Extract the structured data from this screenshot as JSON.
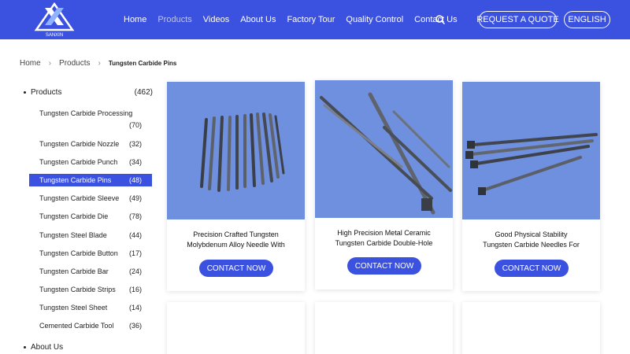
{
  "header": {
    "nav": [
      "Home",
      "Products",
      "Videos",
      "About Us",
      "Factory Tour",
      "Quality Control",
      "Contact Us"
    ],
    "active_nav": "Products",
    "quote_button": "REQUEST A QUOTE",
    "language_button": "ENGLISH",
    "logo_text": "SANXIN"
  },
  "breadcrumb": {
    "home": "Home",
    "products": "Products",
    "current": "Tungsten Carbide Pins"
  },
  "sidebar": {
    "products": {
      "label": "Products",
      "count": "(462)"
    },
    "items": [
      {
        "label": "Tungsten Carbide Processing",
        "count": "(70)"
      },
      {
        "label": "Tungsten Carbide Nozzle",
        "count": "(32)"
      },
      {
        "label": "Tungsten Carbide Punch",
        "count": "(34)"
      },
      {
        "label": "Tungsten Carbide Pins",
        "count": "(48)"
      },
      {
        "label": "Tungsten Carbide Sleeve",
        "count": "(49)"
      },
      {
        "label": "Tungsten Carbide Die",
        "count": "(78)"
      },
      {
        "label": "Tungsten Steel Blade",
        "count": "(44)"
      },
      {
        "label": "Tungsten Carbide Button",
        "count": "(17)"
      },
      {
        "label": "Tungsten Carbide Bar",
        "count": "(24)"
      },
      {
        "label": "Tungsten Carbide Strips",
        "count": "(16)"
      },
      {
        "label": "Tungsten Steel Sheet",
        "count": "(14)"
      },
      {
        "label": "Cemented Carbide Tool",
        "count": "(36)"
      }
    ],
    "about": {
      "label": "About Us"
    }
  },
  "products": [
    {
      "title_line1": "Precision Crafted Tungsten",
      "title_line2": "Molybdenum Alloy Needle With",
      "cta": "CONTACT NOW"
    },
    {
      "title_line1": "High Precision Metal Ceramic",
      "title_line2": "Tungsten Carbide Double-Hole",
      "cta": "CONTACT NOW"
    },
    {
      "title_line1": "Good Physical Stability",
      "title_line2": "Tungsten Carbide Needles For",
      "cta": "CONTACT NOW"
    }
  ],
  "colors": {
    "brand": "#3b51e0",
    "image_bg": "#6e8fe0"
  }
}
